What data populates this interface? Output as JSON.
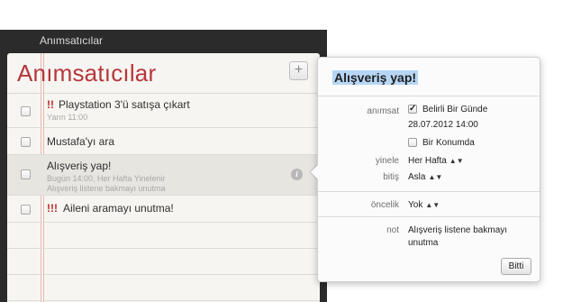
{
  "window": {
    "title": "Anımsatıcılar"
  },
  "list": {
    "title": "Anımsatıcılar",
    "add_label": "+",
    "items": [
      {
        "priority": "!!",
        "title": "Playstation 3'ü satışa çıkart",
        "sub1": "Yarın 11:00",
        "sub2": ""
      },
      {
        "priority": "",
        "title": "Mustafa'yı ara",
        "sub1": "",
        "sub2": ""
      },
      {
        "priority": "",
        "title": "Alışveriş yap!",
        "sub1": "Bugün 14:00, Her Hafta Yinelenir",
        "sub2": "Alışveriş listene bakmayı unutma"
      },
      {
        "priority": "!!!",
        "title": "Aileni aramayı unutma!",
        "sub1": "",
        "sub2": ""
      }
    ],
    "info_label": "i"
  },
  "popover": {
    "title": "Alışveriş yap!",
    "remind_label": "anımsat",
    "on_day_label": "Belirli Bir Günde",
    "on_day_checked": true,
    "date_value": "28.07.2012  14:00",
    "at_location_label": "Bir Konumda",
    "repeat_label": "yinele",
    "repeat_value": "Her Hafta",
    "end_label": "bitiş",
    "end_value": "Asla",
    "priority_label": "öncelik",
    "priority_value": "Yok",
    "note_label": "not",
    "note_line1": "Alışveriş listene bakmayı",
    "note_line2": "unutma",
    "done_label": "Bitti",
    "checkmark": "✓",
    "stepper_glyph": "▲▼"
  },
  "colors": {
    "title_red": "#b5363b",
    "priority_red": "#c0272d",
    "selection_blue": "#b7d6f5"
  }
}
